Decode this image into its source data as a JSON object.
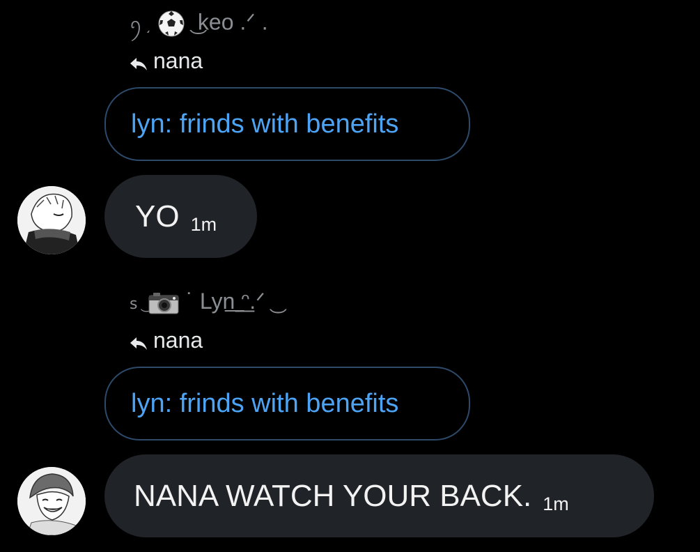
{
  "messages": [
    {
      "sender": {
        "prefix": "ꪆ ͵",
        "emoji": "⚽",
        "name": "͜ keo .ᐟ ."
      },
      "reply_to": "nana",
      "quoted": "lyn: frinds with benefits",
      "text": "YO",
      "time": "1m",
      "avatar_icon": "manga-avatar-white-hair-icon"
    },
    {
      "sender": {
        "prefix": "ꜱ ͜",
        "emoji": "📷",
        "name": "˙ Lyn͟ ͟ᵔ.ᐟ ͜"
      },
      "reply_to": "nana",
      "quoted": "lyn: frinds with benefits",
      "text": "NANA WATCH YOUR BACK.",
      "time": "1m",
      "avatar_icon": "manga-avatar-smiling-icon"
    }
  ],
  "colors": {
    "background": "#000000",
    "bubble": "#202327",
    "quote_border": "#2d4a6b",
    "quote_text": "#4ea4f4",
    "sender_name": "#8b8f94"
  }
}
